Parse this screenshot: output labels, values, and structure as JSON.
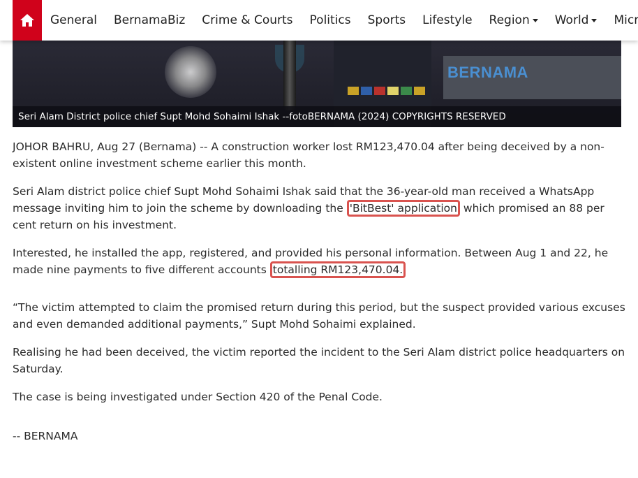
{
  "nav": {
    "items": [
      {
        "label": "General",
        "dropdown": false
      },
      {
        "label": "BernamaBiz",
        "dropdown": false
      },
      {
        "label": "Crime & Courts",
        "dropdown": false
      },
      {
        "label": "Politics",
        "dropdown": false
      },
      {
        "label": "Sports",
        "dropdown": false
      },
      {
        "label": "Lifestyle",
        "dropdown": false
      },
      {
        "label": "Region",
        "dropdown": true
      },
      {
        "label": "World",
        "dropdown": true
      },
      {
        "label": "Micro",
        "dropdown": false
      }
    ],
    "accent_color": "#d0021b"
  },
  "photo": {
    "watermark": "BERNAMA",
    "caption": "Seri Alam District police chief Supt Mohd Sohaimi Ishak --fotoBERNAMA (2024) COPYRIGHTS RESERVED"
  },
  "article": {
    "p1": "JOHOR BAHRU, Aug 27 (Bernama) -- A construction worker lost RM123,470.04 after being deceived by a non-existent online investment scheme earlier this month.",
    "p2": {
      "before": "Seri Alam district police chief Supt Mohd Sohaimi Ishak said that the 36-year-old man received a WhatsApp message inviting him to join the scheme by downloading the ",
      "highlight": "'BitBest' application",
      "after": " which promised an 88 per cent return on his investment."
    },
    "p3": {
      "before": "Interested, he installed the app, registered, and provided his personal information. Between Aug 1 and  22, he made nine payments to five different accounts ",
      "highlight": "totalling RM123,470.04."
    },
    "p4": "“The victim attempted to claim the promised return during this period, but the suspect provided various excuses and even demanded additional payments,” Supt Mohd Sohaimi explained.",
    "p5": "Realising he had been deceived, the victim reported the incident to the Seri Alam district police headquarters on Saturday.",
    "p6": "The case is being investigated under Section 420 of the Penal Code.",
    "signoff": "-- BERNAMA",
    "highlight_color": "#d9534f"
  }
}
